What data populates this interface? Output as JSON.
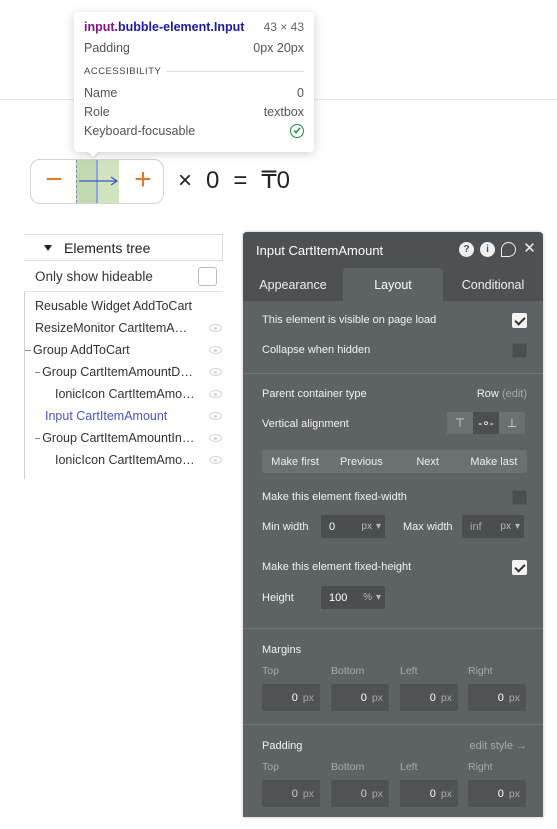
{
  "tooltip": {
    "tag": "input",
    "classes": ".bubble-element.Input",
    "dimensions": "43 × 43",
    "padding_label": "Padding",
    "padding_value": "0px 20px",
    "section": "ACCESSIBILITY",
    "name_label": "Name",
    "name_value": "0",
    "role_label": "Role",
    "role_value": "textbox",
    "focus_label": "Keyboard-focusable"
  },
  "stepper": {
    "minus": "−",
    "plus": "+"
  },
  "equation": {
    "times": "×",
    "zero": "0",
    "equals": "=",
    "result": "₸0"
  },
  "tree": {
    "title": "Elements tree",
    "filter_label": "Only show hideable",
    "items": [
      {
        "label": "Reusable Widget AddToCart"
      },
      {
        "label": "ResizeMonitor CartItemAmount"
      },
      {
        "label": "Group AddToCart"
      },
      {
        "label": "Group CartItemAmountDecrease"
      },
      {
        "label": "IonicIcon CartItemAmountDecrease"
      },
      {
        "label": "Input CartItemAmount"
      },
      {
        "label": "Group CartItemAmountIncrease"
      },
      {
        "label": "IonicIcon CartItemAmountIncrease"
      }
    ]
  },
  "panel": {
    "title": "Input CartItemAmount",
    "tabs": [
      "Appearance",
      "Layout",
      "Conditional"
    ],
    "visible_label": "This element is visible on page load",
    "collapse_label": "Collapse when hidden",
    "parent_label": "Parent container type",
    "parent_value": "Row",
    "parent_edit": "(edit)",
    "valign_label": "Vertical alignment",
    "order_buttons": [
      "Make first",
      "Previous",
      "Next",
      "Make last"
    ],
    "fixed_width_label": "Make this element fixed-width",
    "min_width_label": "Min width",
    "min_width_value": "0",
    "min_width_unit": "px",
    "max_width_label": "Max width",
    "max_width_value": "inf",
    "max_width_unit": "px",
    "fixed_height_label": "Make this element fixed-height",
    "height_label": "Height",
    "height_value": "100",
    "height_unit": "%",
    "margins_label": "Margins",
    "padding_label": "Padding",
    "edit_style": "edit style →",
    "side_labels": [
      "Top",
      "Bottom",
      "Left",
      "Right"
    ],
    "margins": [
      "0",
      "0",
      "0",
      "0"
    ],
    "paddings": [
      "0",
      "0",
      "0",
      "0"
    ],
    "unit": "px"
  }
}
